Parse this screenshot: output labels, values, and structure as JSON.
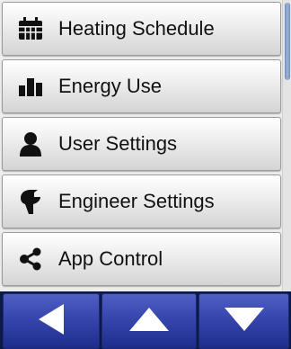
{
  "menu": {
    "items": [
      {
        "label": "Heating Schedule",
        "icon": "calendar-icon"
      },
      {
        "label": "Energy Use",
        "icon": "bar-chart-icon"
      },
      {
        "label": "User Settings",
        "icon": "user-icon"
      },
      {
        "label": "Engineer Settings",
        "icon": "wrench-icon"
      },
      {
        "label": "App Control",
        "icon": "share-icon"
      }
    ]
  },
  "nav": {
    "buttons": [
      {
        "icon": "arrow-left-icon"
      },
      {
        "icon": "arrow-up-icon"
      },
      {
        "icon": "arrow-down-icon"
      }
    ]
  },
  "colors": {
    "nav_button": "#3646ad",
    "nav_background": "#0c1a4a",
    "scroll_thumb": "#7f9ccb"
  }
}
